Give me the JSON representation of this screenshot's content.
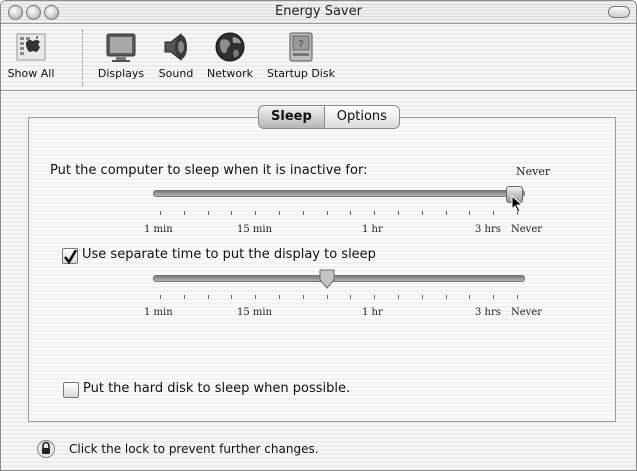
{
  "window": {
    "title": "Energy Saver"
  },
  "toolbar": {
    "items": [
      {
        "label": "Show All",
        "icon": "apple-grid-icon"
      },
      {
        "label": "Displays",
        "icon": "display-icon"
      },
      {
        "label": "Sound",
        "icon": "speaker-icon"
      },
      {
        "label": "Network",
        "icon": "globe-icon"
      },
      {
        "label": "Startup Disk",
        "icon": "hard-disk-icon"
      }
    ]
  },
  "tabs": [
    {
      "label": "Sleep",
      "selected": true
    },
    {
      "label": "Options",
      "selected": false
    }
  ],
  "sleep": {
    "computer_label": "Put the computer to sleep when it is inactive for:",
    "computer_value": "Never",
    "computer_slider_fraction": 1.0,
    "display_checkbox_label": "Use separate time to put the display to sleep",
    "display_checkbox_checked": true,
    "display_slider_fraction": 0.47,
    "slider_ticks_labels": [
      "1 min",
      "15 min",
      "1 hr",
      "3 hrs",
      "Never"
    ],
    "harddisk_label": "Put the hard disk to sleep when possible.",
    "harddisk_checked": false
  },
  "footer": {
    "lock_text": "Click the lock to prevent further changes.",
    "icon": "lock-icon"
  }
}
